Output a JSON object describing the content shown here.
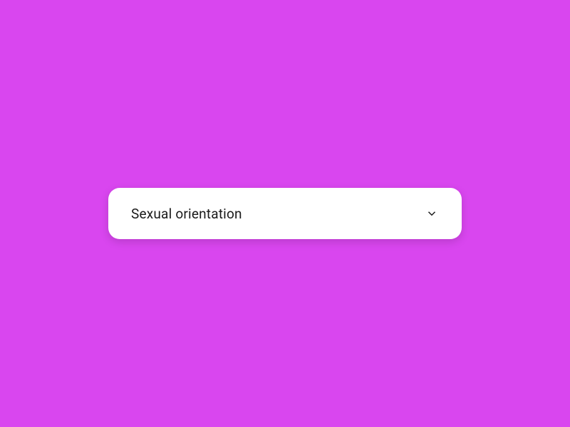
{
  "dropdown": {
    "label": "Sexual orientation"
  }
}
